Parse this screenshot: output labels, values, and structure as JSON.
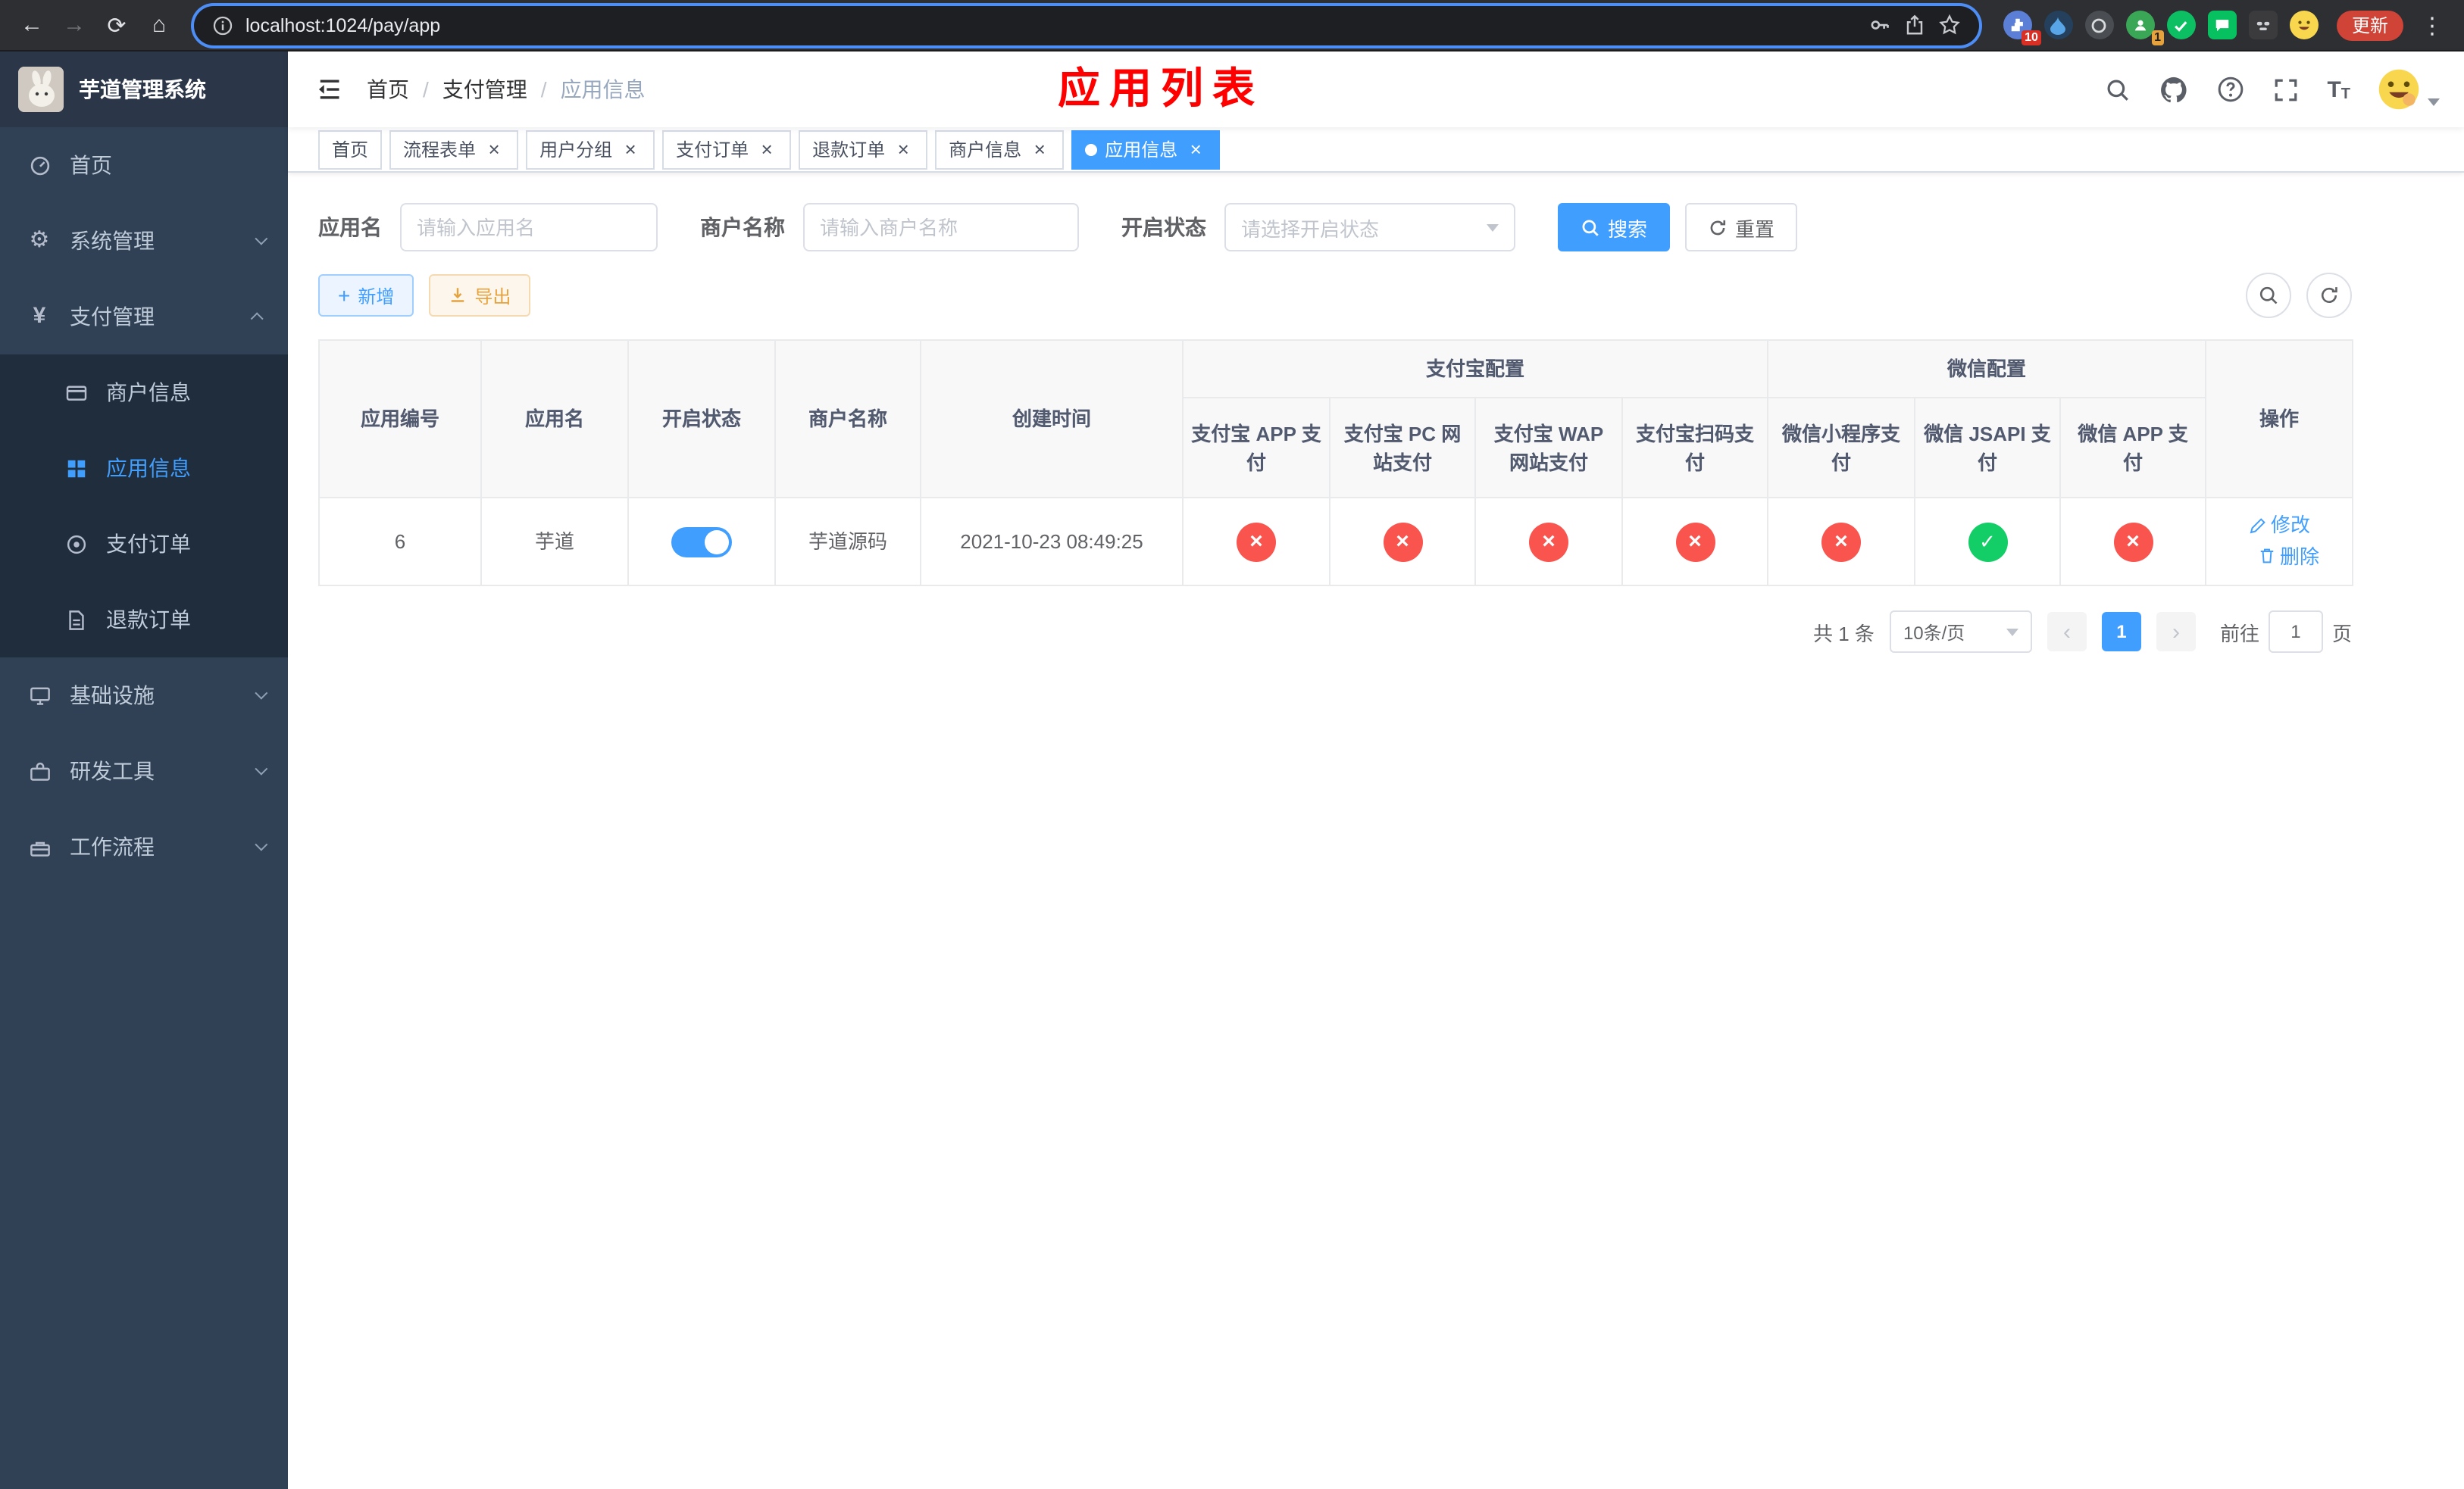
{
  "browser": {
    "url": "localhost:1024/pay/app",
    "update_label": "更新",
    "extensions": {
      "puzzle_badge": "10",
      "green_badge": "1"
    }
  },
  "sidebar": {
    "logo_title": "芋道管理系统",
    "menu": {
      "home": "首页",
      "system": "系统管理",
      "payment": "支付管理",
      "merchant_info": "商户信息",
      "app_info": "应用信息",
      "pay_order": "支付订单",
      "refund_order": "退款订单",
      "infra": "基础设施",
      "dev_tools": "研发工具",
      "workflow": "工作流程"
    }
  },
  "navbar": {
    "breadcrumb": [
      "首页",
      "支付管理",
      "应用信息"
    ],
    "annotation": "应用列表"
  },
  "tags": [
    {
      "label": "首页"
    },
    {
      "label": "流程表单"
    },
    {
      "label": "用户分组"
    },
    {
      "label": "支付订单"
    },
    {
      "label": "退款订单"
    },
    {
      "label": "商户信息"
    },
    {
      "label": "应用信息"
    }
  ],
  "filters": {
    "app_name_label": "应用名",
    "app_name_placeholder": "请输入应用名",
    "merchant_label": "商户名称",
    "merchant_placeholder": "请输入商户名称",
    "status_label": "开启状态",
    "status_placeholder": "请选择开启状态",
    "search_label": "搜索",
    "reset_label": "重置"
  },
  "toolbar": {
    "add_label": "新增",
    "export_label": "导出"
  },
  "table": {
    "group_headers": {
      "alipay": "支付宝配置",
      "wechat": "微信配置"
    },
    "headers": {
      "app_id": "应用编号",
      "app_name": "应用名",
      "status": "开启状态",
      "merchant": "商户名称",
      "created": "创建时间",
      "actions": "操作"
    },
    "sub_headers": [
      "支付宝 APP 支付",
      "支付宝 PC 网站支付",
      "支付宝 WAP 网站支付",
      "支付宝扫码支付",
      "微信小程序支付",
      "微信 JSAPI 支付",
      "微信 APP 支付"
    ],
    "rows": [
      {
        "app_id": "6",
        "app_name": "芋道",
        "status": "enabled",
        "merchant": "芋道源码",
        "created": "2021-10-23 08:49:25",
        "pay_configs": [
          "disabled",
          "disabled",
          "disabled",
          "disabled",
          "disabled",
          "enabled",
          "disabled"
        ],
        "actions": {
          "edit": "修改",
          "delete": "删除"
        }
      }
    ]
  },
  "pagination": {
    "total_label": "共 1 条",
    "page_size_label": "10条/页",
    "current_page": "1",
    "goto_prefix": "前往",
    "goto_value": "1",
    "goto_suffix": "页"
  },
  "colors": {
    "primary": "#409eff",
    "success": "#13ce66",
    "danger": "#f9544e",
    "warning": "#e6a23c",
    "sidebar_bg": "#304156",
    "submenu_bg": "#1f2d3d",
    "annotation": "#ff0000"
  }
}
